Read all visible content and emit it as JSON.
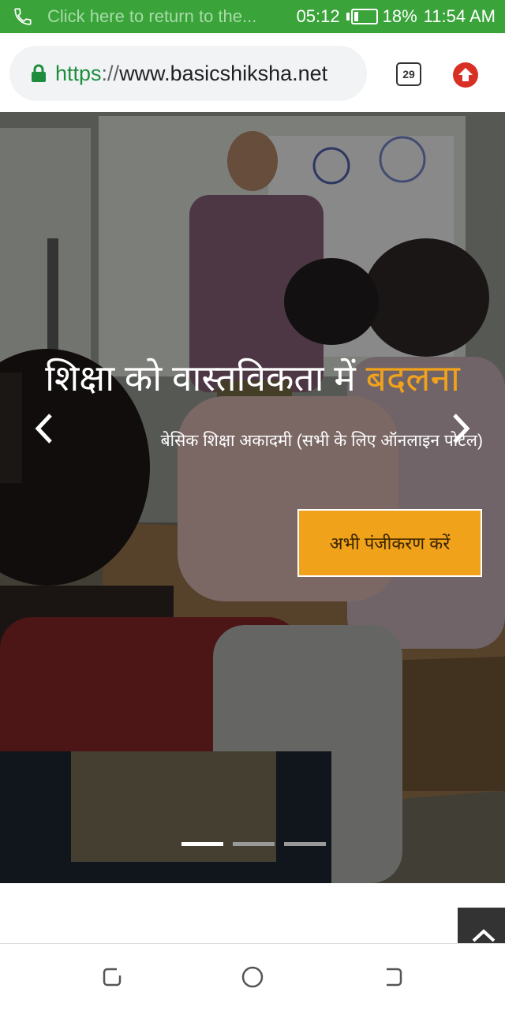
{
  "status_bar": {
    "call_text": "Click here to return to the...",
    "call_timer": "05:12",
    "battery": "18%",
    "battery_level": 0.18,
    "clock": "11:54 AM"
  },
  "browser": {
    "url_scheme": "https",
    "url_separator": "://",
    "url_host": "www.basicshiksha.net",
    "tab_count": "29"
  },
  "hero": {
    "title_main": "शिक्षा को वास्तविकता में ",
    "title_accent": "बदलना",
    "subtitle": "बेसिक शिक्षा अकादमी (सभी के लिए ऑनलाइन पोर्टल)",
    "cta_label": "अभी पंजीकरण करें",
    "slides": 3,
    "active_slide": 1
  },
  "colors": {
    "status_green": "#3aa33a",
    "accent": "#f0a21a",
    "secure_green": "#1e8e3e",
    "update_red": "#d93025"
  },
  "icons": {
    "status": "phone-icon",
    "lock": "lock-icon",
    "update": "update-arrow-icon",
    "prev": "chevron-left-icon",
    "next": "chevron-right-icon",
    "scroll_top": "chevron-up-icon",
    "nav_recents": "recents-icon",
    "nav_home": "home-icon",
    "nav_back": "back-icon"
  }
}
